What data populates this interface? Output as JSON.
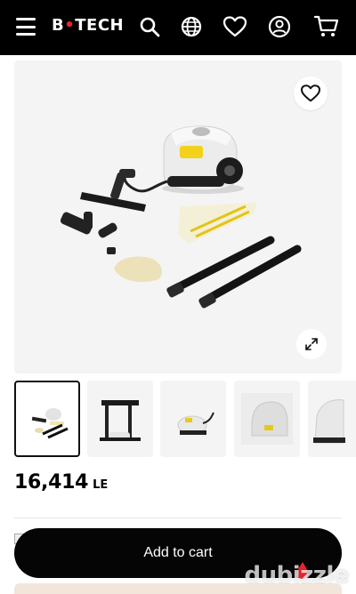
{
  "header": {
    "logo": {
      "left": "B",
      "dot": "•",
      "right": "TECH"
    },
    "icons": [
      "menu-icon",
      "search-icon",
      "globe-icon",
      "heart-icon",
      "user-icon",
      "cart-icon"
    ]
  },
  "gallery": {
    "main_image": "steam-cleaner-with-accessories",
    "thumbnails": [
      {
        "name": "steam-cleaner-accessories",
        "selected": true
      },
      {
        "name": "steam-cleaner-upright-tubes",
        "selected": false
      },
      {
        "name": "steam-cleaner-side-view",
        "selected": false
      },
      {
        "name": "steam-cleaner-closeup",
        "selected": false
      },
      {
        "name": "steam-cleaner-partial",
        "selected": false
      }
    ]
  },
  "product": {
    "price": "16,414",
    "currency": "LE"
  },
  "actions": {
    "add_to_cart_label": "Add to cart"
  },
  "watermark": {
    "text": "dubizzle"
  },
  "colors": {
    "header_bg": "#000000",
    "button_bg": "#050505",
    "accent_red": "#e8252d",
    "image_bg": "#f4f4f4"
  }
}
